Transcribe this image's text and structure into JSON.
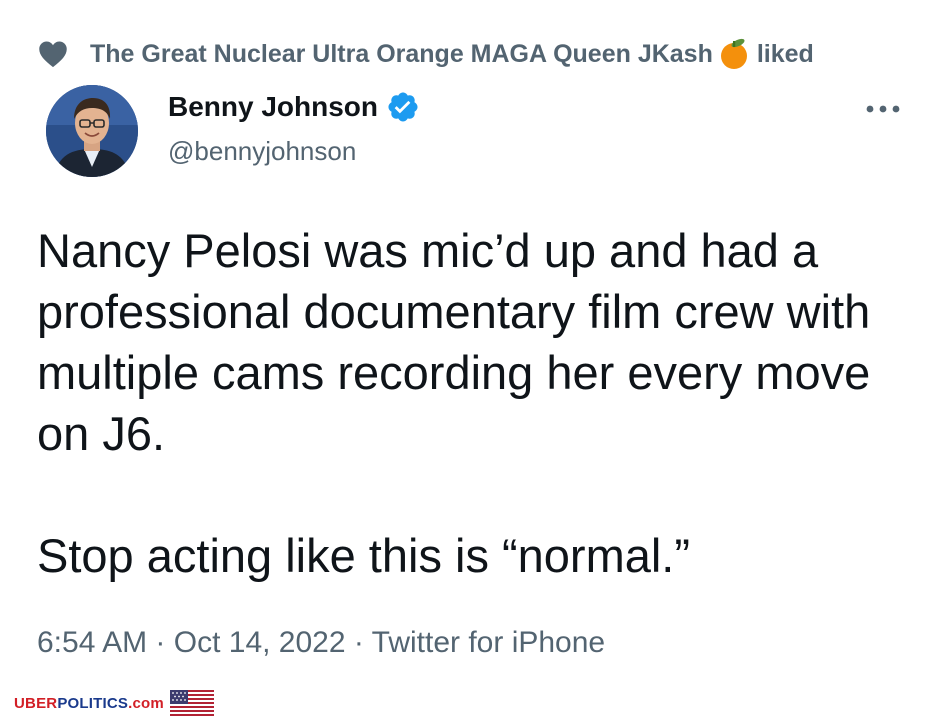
{
  "social_context": {
    "icon": "heart-icon",
    "user_name": "The Great Nuclear Ultra Orange MAGA Queen JKash",
    "emoji": "orange-emoji",
    "action": "liked"
  },
  "author": {
    "display_name": "Benny Johnson",
    "handle": "@bennyjohnson",
    "verified_icon": "verified-badge-icon",
    "avatar": "profile-avatar"
  },
  "menu": {
    "icon": "more-options-icon"
  },
  "tweet": {
    "paragraph_1": "Nancy Pelosi was mic’d up and had a professional documentary film crew with multiple cams recording her every move on J6.",
    "paragraph_2": "Stop acting like this is “normal.”"
  },
  "metadata": {
    "time": "6:54 AM",
    "separator_1": " · ",
    "date": "Oct 14, 2022",
    "separator_2": " · ",
    "source": "Twitter for iPhone"
  },
  "watermark": {
    "part_1": "UBER",
    "part_2": "POLITICS",
    "part_3": ".com",
    "flag_icon": "us-flag-icon"
  },
  "colors": {
    "primary_text": "#0f1419",
    "secondary_text": "#536471",
    "verified_blue": "#1d9bf0",
    "orange": "#f4900c"
  }
}
